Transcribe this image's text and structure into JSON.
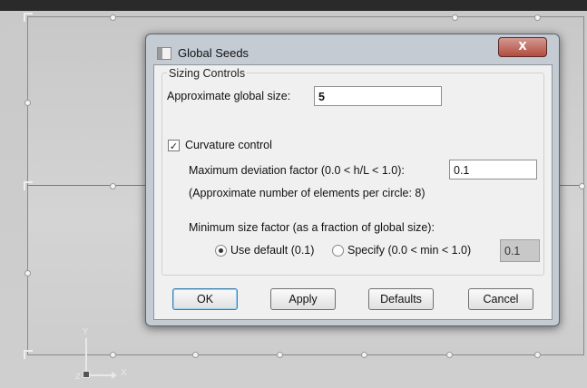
{
  "dialog": {
    "title": "Global Seeds",
    "close_label": "X",
    "group_title": "Sizing Controls",
    "global_size_label": "Approximate global size:",
    "global_size_value": "5",
    "curvature_label": "Curvature control",
    "curvature_checked": true,
    "check_glyph": "✓",
    "deviation_label": "Maximum deviation factor (0.0 < h/L < 1.0):",
    "deviation_value": "0.1",
    "elements_note": "(Approximate number of elements per circle: 8)",
    "min_size_label": "Minimum size factor (as a fraction of global size):",
    "use_default_label": "Use default (0.1)",
    "specify_label": "Specify (0.0 < min < 1.0)",
    "specify_value": "0.1",
    "selected_min_size_option": "use-default",
    "buttons": {
      "ok": "OK",
      "apply": "Apply",
      "defaults": "Defaults",
      "cancel": "Cancel"
    }
  },
  "viewport": {
    "axis_y": "Y",
    "axis_x": "X",
    "axis_z": "Z"
  },
  "colors": {
    "close_button": "#b44b3e",
    "dialog_frame": "#c4cbd3",
    "viewport_part": "#cfcfcf"
  }
}
